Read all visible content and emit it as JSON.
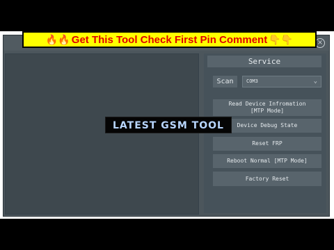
{
  "promo": {
    "left_emoji": "🔥🔥",
    "text": "Get This Tool Check First Pin Comment",
    "right_emoji": "👇👇"
  },
  "window": {
    "close_glyph": "×"
  },
  "service_panel": {
    "title": "Service",
    "scan_label": "Scan",
    "port_value": "COM3",
    "buttons": [
      {
        "line1": "Read Device Infromation",
        "line2": "[MTP Mode]"
      },
      {
        "line1": "Device Debug State",
        "line2": ""
      },
      {
        "line1": "Reset FRP",
        "line2": ""
      },
      {
        "line1": "Reboot Normal [MTP Mode]",
        "line2": ""
      },
      {
        "line1": "Factory Reset",
        "line2": ""
      }
    ]
  },
  "overlay": {
    "stamp_text": "LATEST GSM TOOL"
  },
  "colors": {
    "promo_bg": "#ffff00",
    "promo_text": "#e00000",
    "window_bg": "#4c565c",
    "panel_bg": "#46525a",
    "button_bg": "#58646c",
    "stamp_text": "#b8d6ff"
  }
}
